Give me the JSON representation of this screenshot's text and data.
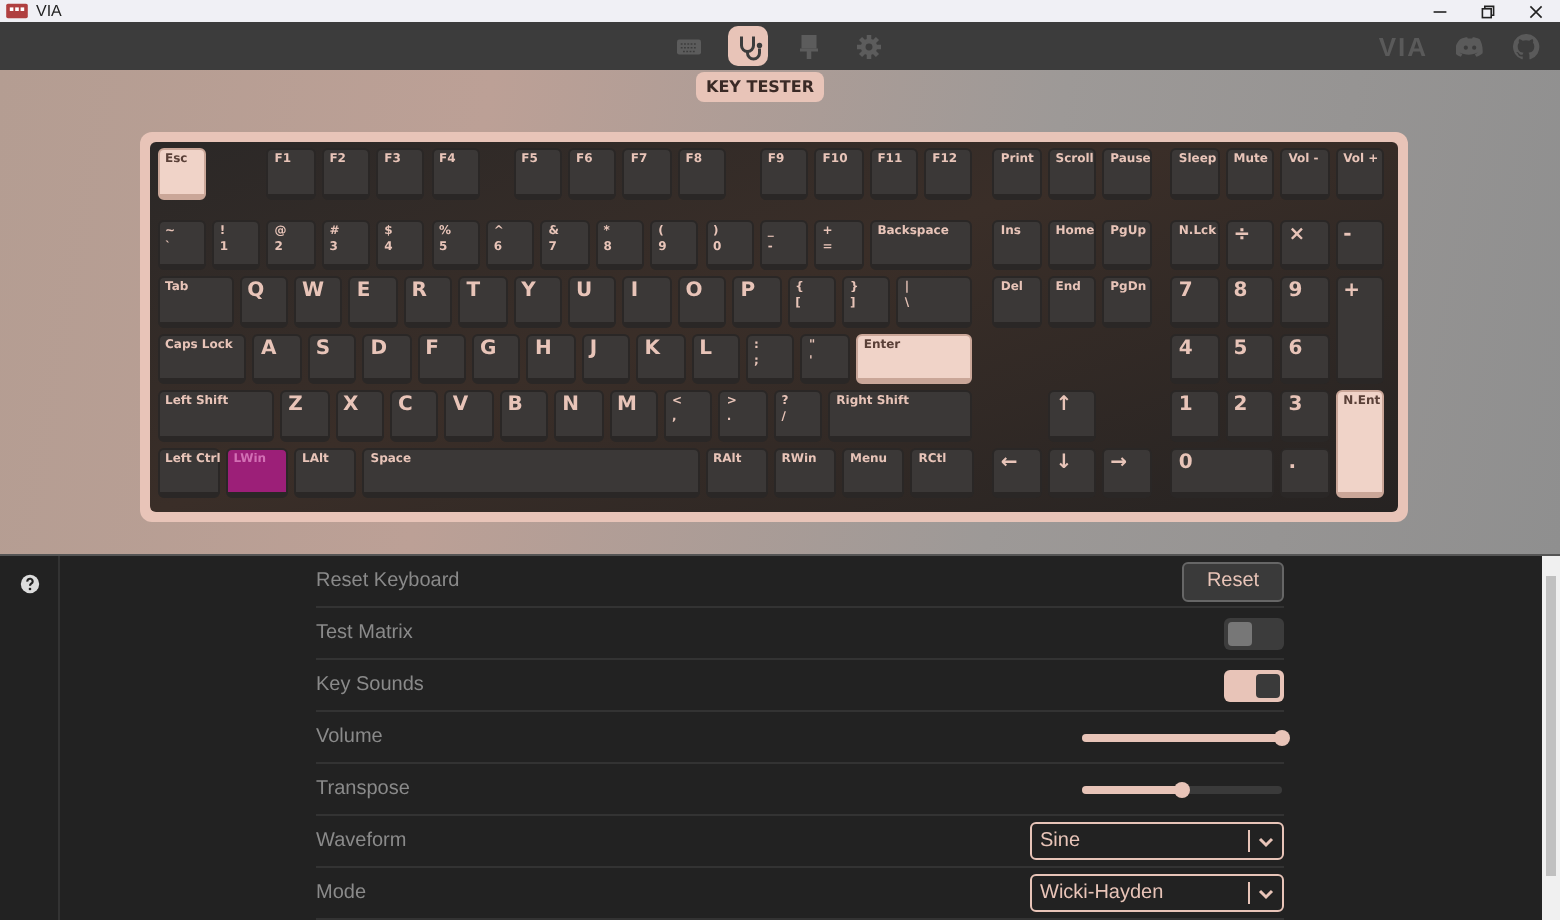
{
  "window": {
    "title": "VIA"
  },
  "nav": {
    "items": [
      {
        "kind": "keyboard",
        "selected": false
      },
      {
        "kind": "stethoscope",
        "selected": true
      },
      {
        "kind": "brush",
        "selected": false
      },
      {
        "kind": "gear",
        "selected": false
      }
    ],
    "tooltip": "KEY TESTER",
    "logo": "VIA"
  },
  "keyboard": {
    "keys": [
      {
        "legends": [
          "Esc"
        ],
        "tested": true,
        "pressed": false
      },
      {
        "legends": [
          "F1"
        ],
        "tested": false,
        "pressed": false
      },
      {
        "legends": [
          "F2"
        ],
        "tested": false,
        "pressed": false
      },
      {
        "legends": [
          "F3"
        ],
        "tested": false,
        "pressed": false
      },
      {
        "legends": [
          "F4"
        ],
        "tested": false,
        "pressed": false
      },
      {
        "legends": [
          "F5"
        ],
        "tested": false,
        "pressed": false
      },
      {
        "legends": [
          "F6"
        ],
        "tested": false,
        "pressed": false
      },
      {
        "legends": [
          "F7"
        ],
        "tested": false,
        "pressed": false
      },
      {
        "legends": [
          "F8"
        ],
        "tested": false,
        "pressed": false
      },
      {
        "legends": [
          "F9"
        ],
        "tested": false,
        "pressed": false
      },
      {
        "legends": [
          "F10"
        ],
        "tested": false,
        "pressed": false
      },
      {
        "legends": [
          "F11"
        ],
        "tested": false,
        "pressed": false
      },
      {
        "legends": [
          "F12"
        ],
        "tested": false,
        "pressed": false
      },
      {
        "legends": [
          "Print"
        ],
        "tested": false,
        "pressed": false
      },
      {
        "legends": [
          "Scroll"
        ],
        "tested": false,
        "pressed": false
      },
      {
        "legends": [
          "Pause"
        ],
        "tested": false,
        "pressed": false
      },
      {
        "legends": [
          "Sleep"
        ],
        "tested": false,
        "pressed": false
      },
      {
        "legends": [
          "Mute"
        ],
        "tested": false,
        "pressed": false
      },
      {
        "legends": [
          "Vol -"
        ],
        "tested": false,
        "pressed": false
      },
      {
        "legends": [
          "Vol +"
        ],
        "tested": false,
        "pressed": false
      },
      {
        "legends": [
          "~",
          "`"
        ],
        "tested": false,
        "pressed": false
      },
      {
        "legends": [
          "!",
          "1"
        ],
        "tested": false,
        "pressed": false
      },
      {
        "legends": [
          "@",
          "2"
        ],
        "tested": false,
        "pressed": false
      },
      {
        "legends": [
          "#",
          "3"
        ],
        "tested": false,
        "pressed": false
      },
      {
        "legends": [
          "$",
          "4"
        ],
        "tested": false,
        "pressed": false
      },
      {
        "legends": [
          "%",
          "5"
        ],
        "tested": false,
        "pressed": false
      },
      {
        "legends": [
          "^",
          "6"
        ],
        "tested": false,
        "pressed": false
      },
      {
        "legends": [
          "&",
          "7"
        ],
        "tested": false,
        "pressed": false
      },
      {
        "legends": [
          "*",
          "8"
        ],
        "tested": false,
        "pressed": false
      },
      {
        "legends": [
          "(",
          "9"
        ],
        "tested": false,
        "pressed": false
      },
      {
        "legends": [
          ")",
          "0"
        ],
        "tested": false,
        "pressed": false
      },
      {
        "legends": [
          "_",
          "-"
        ],
        "tested": false,
        "pressed": false
      },
      {
        "legends": [
          "+",
          "="
        ],
        "tested": false,
        "pressed": false
      },
      {
        "legends": [
          "Backspace"
        ],
        "tested": false,
        "pressed": false
      },
      {
        "legends": [
          "Ins"
        ],
        "tested": false,
        "pressed": false
      },
      {
        "legends": [
          "Home"
        ],
        "tested": false,
        "pressed": false
      },
      {
        "legends": [
          "PgUp"
        ],
        "tested": false,
        "pressed": false
      },
      {
        "legends": [
          "N.Lck"
        ],
        "tested": false,
        "pressed": false
      },
      {
        "legends": [
          "÷"
        ],
        "tested": false,
        "pressed": false
      },
      {
        "legends": [
          "×"
        ],
        "tested": false,
        "pressed": false
      },
      {
        "legends": [
          "-"
        ],
        "tested": false,
        "pressed": false
      },
      {
        "legends": [
          "Tab"
        ],
        "tested": false,
        "pressed": false
      },
      {
        "legends": [
          "Q"
        ],
        "tested": false,
        "pressed": false
      },
      {
        "legends": [
          "W"
        ],
        "tested": false,
        "pressed": false
      },
      {
        "legends": [
          "E"
        ],
        "tested": false,
        "pressed": false
      },
      {
        "legends": [
          "R"
        ],
        "tested": false,
        "pressed": false
      },
      {
        "legends": [
          "T"
        ],
        "tested": false,
        "pressed": false
      },
      {
        "legends": [
          "Y"
        ],
        "tested": false,
        "pressed": false
      },
      {
        "legends": [
          "U"
        ],
        "tested": false,
        "pressed": false
      },
      {
        "legends": [
          "I"
        ],
        "tested": false,
        "pressed": false
      },
      {
        "legends": [
          "O"
        ],
        "tested": false,
        "pressed": false
      },
      {
        "legends": [
          "P"
        ],
        "tested": false,
        "pressed": false
      },
      {
        "legends": [
          "{",
          "["
        ],
        "tested": false,
        "pressed": false
      },
      {
        "legends": [
          "}",
          "]"
        ],
        "tested": false,
        "pressed": false
      },
      {
        "legends": [
          "|",
          "\\"
        ],
        "tested": false,
        "pressed": false
      },
      {
        "legends": [
          "Del"
        ],
        "tested": false,
        "pressed": false
      },
      {
        "legends": [
          "End"
        ],
        "tested": false,
        "pressed": false
      },
      {
        "legends": [
          "PgDn"
        ],
        "tested": false,
        "pressed": false
      },
      {
        "legends": [
          "7"
        ],
        "tested": false,
        "pressed": false
      },
      {
        "legends": [
          "8"
        ],
        "tested": false,
        "pressed": false
      },
      {
        "legends": [
          "9"
        ],
        "tested": false,
        "pressed": false
      },
      {
        "legends": [
          "+"
        ],
        "tested": false,
        "pressed": false
      },
      {
        "legends": [
          "Caps Lock"
        ],
        "tested": false,
        "pressed": false
      },
      {
        "legends": [
          "A"
        ],
        "tested": false,
        "pressed": false
      },
      {
        "legends": [
          "S"
        ],
        "tested": false,
        "pressed": false
      },
      {
        "legends": [
          "D"
        ],
        "tested": false,
        "pressed": false
      },
      {
        "legends": [
          "F"
        ],
        "tested": false,
        "pressed": false
      },
      {
        "legends": [
          "G"
        ],
        "tested": false,
        "pressed": false
      },
      {
        "legends": [
          "H"
        ],
        "tested": false,
        "pressed": false
      },
      {
        "legends": [
          "J"
        ],
        "tested": false,
        "pressed": false
      },
      {
        "legends": [
          "K"
        ],
        "tested": false,
        "pressed": false
      },
      {
        "legends": [
          "L"
        ],
        "tested": false,
        "pressed": false
      },
      {
        "legends": [
          ":",
          ";"
        ],
        "tested": false,
        "pressed": false
      },
      {
        "legends": [
          "\"",
          "'"
        ],
        "tested": false,
        "pressed": false
      },
      {
        "legends": [
          "Enter"
        ],
        "tested": true,
        "pressed": false
      },
      {
        "legends": [
          "4"
        ],
        "tested": false,
        "pressed": false
      },
      {
        "legends": [
          "5"
        ],
        "tested": false,
        "pressed": false
      },
      {
        "legends": [
          "6"
        ],
        "tested": false,
        "pressed": false
      },
      {
        "legends": [
          "Left Shift"
        ],
        "tested": false,
        "pressed": false
      },
      {
        "legends": [
          "Z"
        ],
        "tested": false,
        "pressed": false
      },
      {
        "legends": [
          "X"
        ],
        "tested": false,
        "pressed": false
      },
      {
        "legends": [
          "C"
        ],
        "tested": false,
        "pressed": false
      },
      {
        "legends": [
          "V"
        ],
        "tested": false,
        "pressed": false
      },
      {
        "legends": [
          "B"
        ],
        "tested": false,
        "pressed": false
      },
      {
        "legends": [
          "N"
        ],
        "tested": false,
        "pressed": false
      },
      {
        "legends": [
          "M"
        ],
        "tested": false,
        "pressed": false
      },
      {
        "legends": [
          "<",
          ","
        ],
        "tested": false,
        "pressed": false
      },
      {
        "legends": [
          ">",
          "."
        ],
        "tested": false,
        "pressed": false
      },
      {
        "legends": [
          "?",
          "/"
        ],
        "tested": false,
        "pressed": false
      },
      {
        "legends": [
          "Right Shift"
        ],
        "tested": false,
        "pressed": false
      },
      {
        "legends": [
          "↑"
        ],
        "tested": false,
        "pressed": false
      },
      {
        "legends": [
          "1"
        ],
        "tested": false,
        "pressed": false
      },
      {
        "legends": [
          "2"
        ],
        "tested": false,
        "pressed": false
      },
      {
        "legends": [
          "3"
        ],
        "tested": false,
        "pressed": false
      },
      {
        "legends": [
          "N.Ent"
        ],
        "tested": true,
        "pressed": false
      },
      {
        "legends": [
          "Left Ctrl"
        ],
        "tested": false,
        "pressed": false
      },
      {
        "legends": [
          "LWin"
        ],
        "tested": false,
        "pressed": true
      },
      {
        "legends": [
          "LAlt"
        ],
        "tested": false,
        "pressed": false
      },
      {
        "legends": [
          "Space"
        ],
        "tested": false,
        "pressed": false
      },
      {
        "legends": [
          "RAlt"
        ],
        "tested": false,
        "pressed": false
      },
      {
        "legends": [
          "RWin"
        ],
        "tested": false,
        "pressed": false
      },
      {
        "legends": [
          "Menu"
        ],
        "tested": false,
        "pressed": false
      },
      {
        "legends": [
          "RCtl"
        ],
        "tested": false,
        "pressed": false
      },
      {
        "legends": [
          "←"
        ],
        "tested": false,
        "pressed": false
      },
      {
        "legends": [
          "↓"
        ],
        "tested": false,
        "pressed": false
      },
      {
        "legends": [
          "→"
        ],
        "tested": false,
        "pressed": false
      },
      {
        "legends": [
          "0"
        ],
        "tested": false,
        "pressed": false
      },
      {
        "legends": [
          "."
        ],
        "tested": false,
        "pressed": false
      }
    ]
  },
  "settings": [
    {
      "kind": "button",
      "label": "Reset Keyboard",
      "button": "Reset"
    },
    {
      "kind": "toggle",
      "label": "Test Matrix",
      "on": false
    },
    {
      "kind": "toggle",
      "label": "Key Sounds",
      "on": true
    },
    {
      "kind": "slider",
      "label": "Volume",
      "level": 1.0
    },
    {
      "kind": "slider",
      "label": "Transpose",
      "level": 0.5
    },
    {
      "kind": "select",
      "label": "Waveform",
      "value": "Sine"
    },
    {
      "kind": "select",
      "label": "Mode",
      "value": "Wicki-Hayden"
    }
  ]
}
